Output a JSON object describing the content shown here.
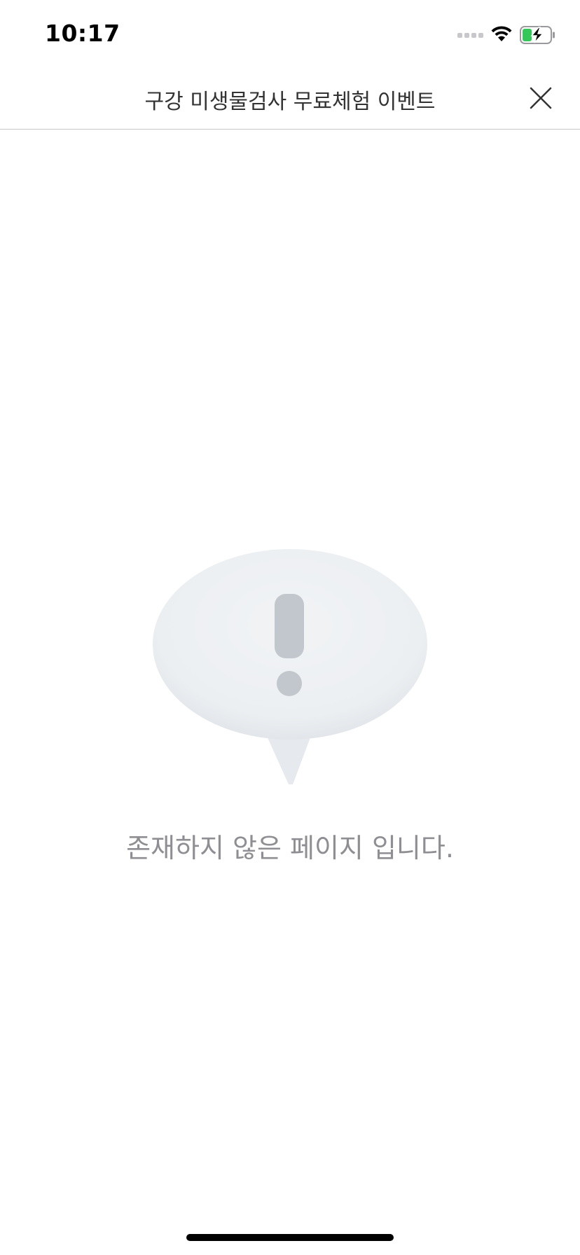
{
  "status_bar": {
    "time": "10:17",
    "icons": [
      "cellular-signal-icon",
      "wifi-icon",
      "battery-charging-icon"
    ],
    "battery_color": "#34c759"
  },
  "nav": {
    "title": "구강 미생물검사 무료체험 이벤트",
    "close_icon": "close-icon"
  },
  "empty_state": {
    "icon": "alert-speech-bubble-icon",
    "message": "존재하지 않은 페이지 입니다."
  },
  "colors": {
    "bubble": "#eceff2",
    "exclamation": "#c2c7cd",
    "message_text": "#8e8e93"
  }
}
